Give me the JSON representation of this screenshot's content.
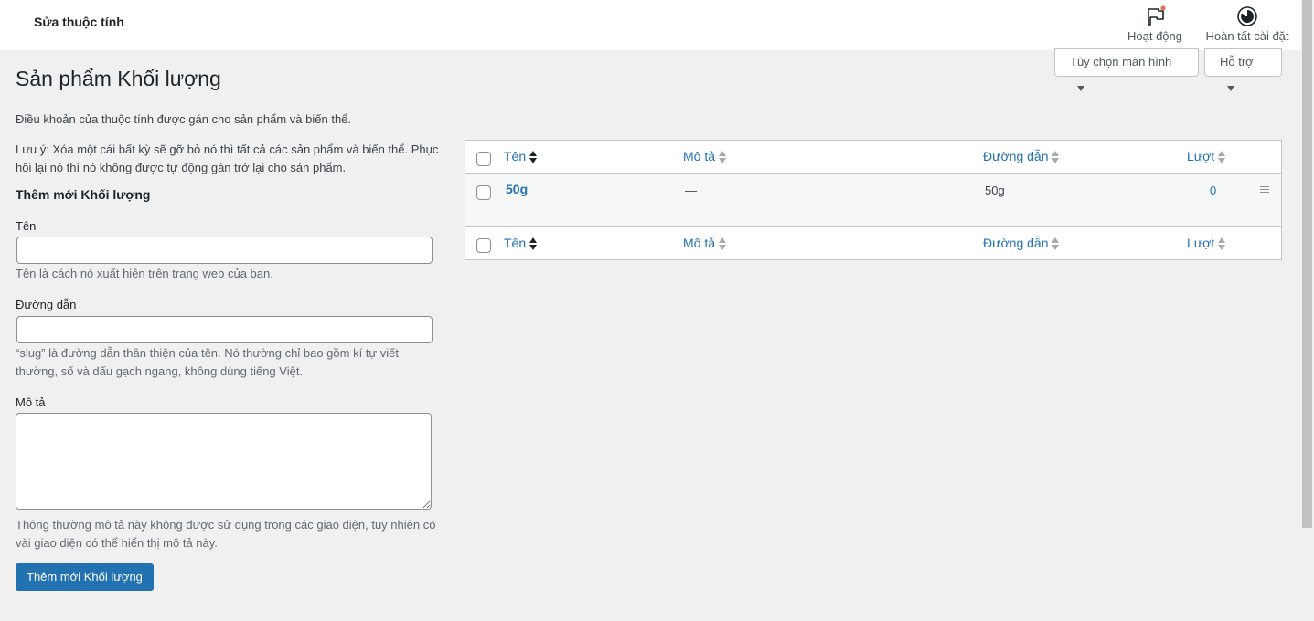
{
  "header": {
    "title": "Sửa thuộc tính",
    "activity_label": "Hoạt động",
    "finish_setup_label": "Hoàn tất cài đặt",
    "activity_icon": "flag-icon",
    "finish_icon": "progress-circle-icon",
    "notification_dot_color": "#e26f56"
  },
  "screen_options": {
    "screen_options_label": "Tùy chọn màn hình",
    "help_label": "Hỗ trợ"
  },
  "page": {
    "title": "Sản phẩm Khối lượng",
    "description": "Điều khoản của thuộc tính được gán cho sản phẩm và biến thể.",
    "note": "Lưu ý: Xóa một cái bất kỳ sẽ gỡ bỏ nó thì tất cả các sản phẩm và biến thể. Phục hồi lại nó thì nó không được tự động gán trở lại cho sản phẩm."
  },
  "form": {
    "title": "Thêm mới Khối lượng",
    "name_label": "Tên",
    "name_value": "",
    "name_help": "Tên là cách nó xuất hiện trên trang web của bạn.",
    "slug_label": "Đường dẫn",
    "slug_value": "",
    "slug_help": "“slug” là đường dẫn thân thiện của tên. Nó thường chỉ bao gồm kí tự viết thường, số và dấu gạch ngang, không dùng tiếng Việt.",
    "description_label": "Mô tả",
    "description_value": "",
    "description_help": "Thông thường mô tả này không được sử dụng trong các giao diện, tuy nhiên có vài giao diện có thể hiển thị mô tả này.",
    "submit_label": "Thêm mới Khối lượng"
  },
  "table": {
    "columns": {
      "name": "Tên",
      "description": "Mô tả",
      "slug": "Đường dẫn",
      "count": "Lượt"
    },
    "rows": [
      {
        "name": "50g",
        "description": "—",
        "slug": "50g",
        "count": "0"
      }
    ]
  },
  "colors": {
    "accent": "#2271b1",
    "background": "#f0f0f1",
    "row_alt": "#f6f7f7"
  }
}
